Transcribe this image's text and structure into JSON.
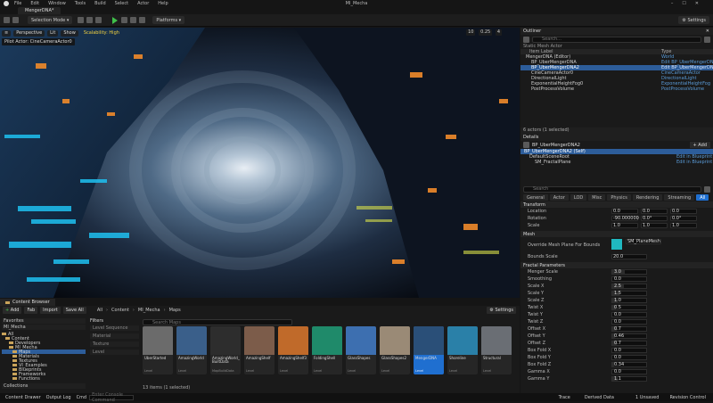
{
  "menubar": {
    "items": [
      "File",
      "Edit",
      "Window",
      "Tools",
      "Build",
      "Select",
      "Actor",
      "Help"
    ],
    "project": "MI_Mecha"
  },
  "tabbar": {
    "level_tab": "MengerDNA*"
  },
  "toolbar": {
    "mode": "Selection Mode",
    "platforms": "Platforms",
    "settings": "Settings"
  },
  "viewport": {
    "perspective": "Perspective",
    "lit": "Lit",
    "show": "Show",
    "scalability": "Scalability: High",
    "pilot": "Pilot Actor: CineCameraActor0",
    "right_vals": [
      "10",
      "0.25",
      "4"
    ]
  },
  "outliner": {
    "title": "Outliner",
    "search_placeholder": "Search...",
    "filter": "Static Mesh Actor",
    "col_label": "Item Label",
    "col_type": "Type",
    "rows": [
      {
        "label": "MengerDNA (Editor)",
        "type": "World"
      },
      {
        "label": "BP_UberMengerDNA",
        "type": "Edit BP_UberMengerDNA"
      },
      {
        "label": "BP_UberMengerDNA2",
        "type": "Edit BP_UberMengerDNA"
      },
      {
        "label": "CineCameraActor0",
        "type": "CineCameraActor"
      },
      {
        "label": "DirectionalLight",
        "type": "DirectionalLight"
      },
      {
        "label": "ExponentialHeightFog0",
        "type": "ExponentialHeightFog"
      },
      {
        "label": "PostProcessVolume",
        "type": "PostProcessVolume"
      }
    ],
    "count": "6 actors (1 selected)"
  },
  "details": {
    "title": "Details",
    "object": "BP_UberMengerDNA2",
    "add": "+ Add",
    "components": [
      {
        "label": "BP_UberMengerDNA2 (Self)",
        "type": ""
      },
      {
        "label": "DefaultSceneRoot",
        "type": "Edit in Blueprint"
      },
      {
        "label": "SM_FractalPlane",
        "type": "Edit in Blueprint"
      }
    ],
    "search_placeholder": "Search",
    "tabs": [
      "General",
      "Actor",
      "LOD",
      "Misc",
      "Physics",
      "Rendering",
      "Streaming",
      "All"
    ],
    "transform": {
      "title": "Transform",
      "rows": [
        {
          "label": "Location",
          "v": [
            "0.0",
            "0.0",
            "0.0"
          ]
        },
        {
          "label": "Rotation",
          "v": [
            "-90.000000",
            "0.0°",
            "0.0°"
          ]
        },
        {
          "label": "Scale",
          "v": [
            "1.0",
            "1.0",
            "1.0"
          ]
        }
      ]
    },
    "mesh": {
      "title": "Mesh",
      "label": "Override Mesh Plane For Bounds",
      "asset": "SM_PlaneMesh",
      "bounds_label": "Bounds Scale",
      "bounds": "20.0"
    },
    "fractal": {
      "title": "Fractal Parameters",
      "rows": [
        {
          "label": "Menger Scale",
          "value": "3.0",
          "fill": 0.38
        },
        {
          "label": "Smoothing",
          "value": "0.0",
          "fill": 0.0
        },
        {
          "label": "Scale X",
          "value": "2.5",
          "fill": 0.34
        },
        {
          "label": "Scale Y",
          "value": "1.5",
          "fill": 0.2
        },
        {
          "label": "Scale Z",
          "value": "1.0",
          "fill": 0.15
        },
        {
          "label": "Twist X",
          "value": "0.5",
          "fill": 0.1
        },
        {
          "label": "Twist Y",
          "value": "0.0",
          "fill": 0.0
        },
        {
          "label": "Twist Z",
          "value": "0.0",
          "fill": 0.0
        },
        {
          "label": "Offset X",
          "value": "0.7",
          "fill": 0.12
        },
        {
          "label": "Offset Y",
          "value": "0.46",
          "fill": 0.08
        },
        {
          "label": "Offset Z",
          "value": "0.7",
          "fill": 0.12
        },
        {
          "label": "Box Fold X",
          "value": "0.0",
          "fill": 0.0
        },
        {
          "label": "Box Fold Y",
          "value": "0.0",
          "fill": 0.0
        },
        {
          "label": "Box Fold Z",
          "value": "0.34",
          "fill": 0.06
        },
        {
          "label": "Gamma X",
          "value": "0.0",
          "fill": 0.0
        },
        {
          "label": "Gamma Y",
          "value": "1.1",
          "fill": 0.16
        }
      ]
    }
  },
  "content_browser": {
    "tab": "Content Browser",
    "add": "Add",
    "import": "Import",
    "save_all": "Save All",
    "fab": "Fab",
    "breadcrumb": [
      "All",
      "Content",
      "MI_Mecha",
      "Maps"
    ],
    "settings": "Settings",
    "favorites": "Favorites",
    "project": "MI_Mecha",
    "search_placeholder": "Search Maps",
    "filters_title": "Filters",
    "filters": [
      "Level Sequence",
      "Material",
      "Texture",
      "Level"
    ],
    "tree": [
      "All",
      "Content",
      "Developers",
      "MI_Mecha",
      "Maps",
      "Materials",
      "Textures",
      "VI_Examples",
      "Blueprints",
      "Frameworks",
      "Functions"
    ],
    "collections": "Collections",
    "assets": [
      {
        "name": "UberStarted",
        "type": "Level",
        "color": "#6b6b6b"
      },
      {
        "name": "AmazingWorld",
        "type": "Level",
        "color": "#3a5f8a"
      },
      {
        "name": "AmazingWorld_BuiltData",
        "type": "MapBuildData",
        "color": "#2d2d2d"
      },
      {
        "name": "AmazingShelf",
        "type": "Level",
        "color": "#7c5c4a"
      },
      {
        "name": "AmazingShelf3",
        "type": "Level",
        "color": "#c06a2a"
      },
      {
        "name": "FoldingShell",
        "type": "Level",
        "color": "#1f8a6a"
      },
      {
        "name": "GlassShapes",
        "type": "Level",
        "color": "#3d6fb0"
      },
      {
        "name": "GlassShapes2",
        "type": "Level",
        "color": "#9a8a76"
      },
      {
        "name": "MengerDNA",
        "type": "Level",
        "color": "#2a4f78"
      },
      {
        "name": "Shoreline",
        "type": "Level",
        "color": "#2a80a8"
      },
      {
        "name": "Structural",
        "type": "Level",
        "color": "#6a6e74"
      }
    ],
    "count": "13 items (1 selected)"
  },
  "statusbar": {
    "drawer": "Content Drawer",
    "output": "Output Log",
    "cmd": "Cmd",
    "console": "Enter Console Command",
    "trace": "Trace",
    "derived": "Derived Data",
    "unsaved": "1 Unsaved",
    "revision": "Revision Control"
  }
}
